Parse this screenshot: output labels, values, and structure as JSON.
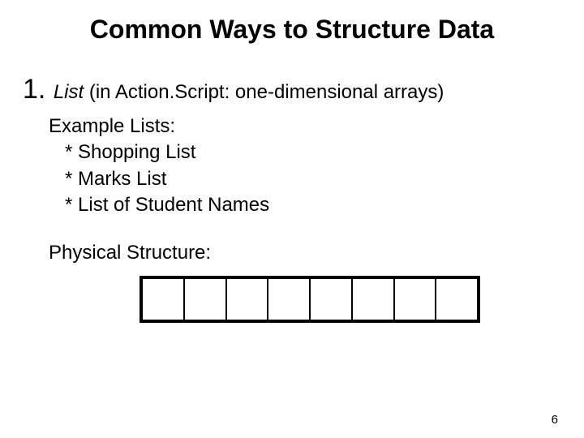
{
  "title": "Common Ways to Structure Data",
  "item": {
    "number": "1. ",
    "term": "List",
    "rest": " (in Action.Script: one-dimensional arrays)"
  },
  "example": {
    "label": "Example Lists:",
    "bullets": [
      "*  Shopping List",
      "*  Marks List",
      "*  List of Student Names"
    ]
  },
  "physical_label": "Physical Structure:",
  "array_cells": 8,
  "page_number": "6"
}
